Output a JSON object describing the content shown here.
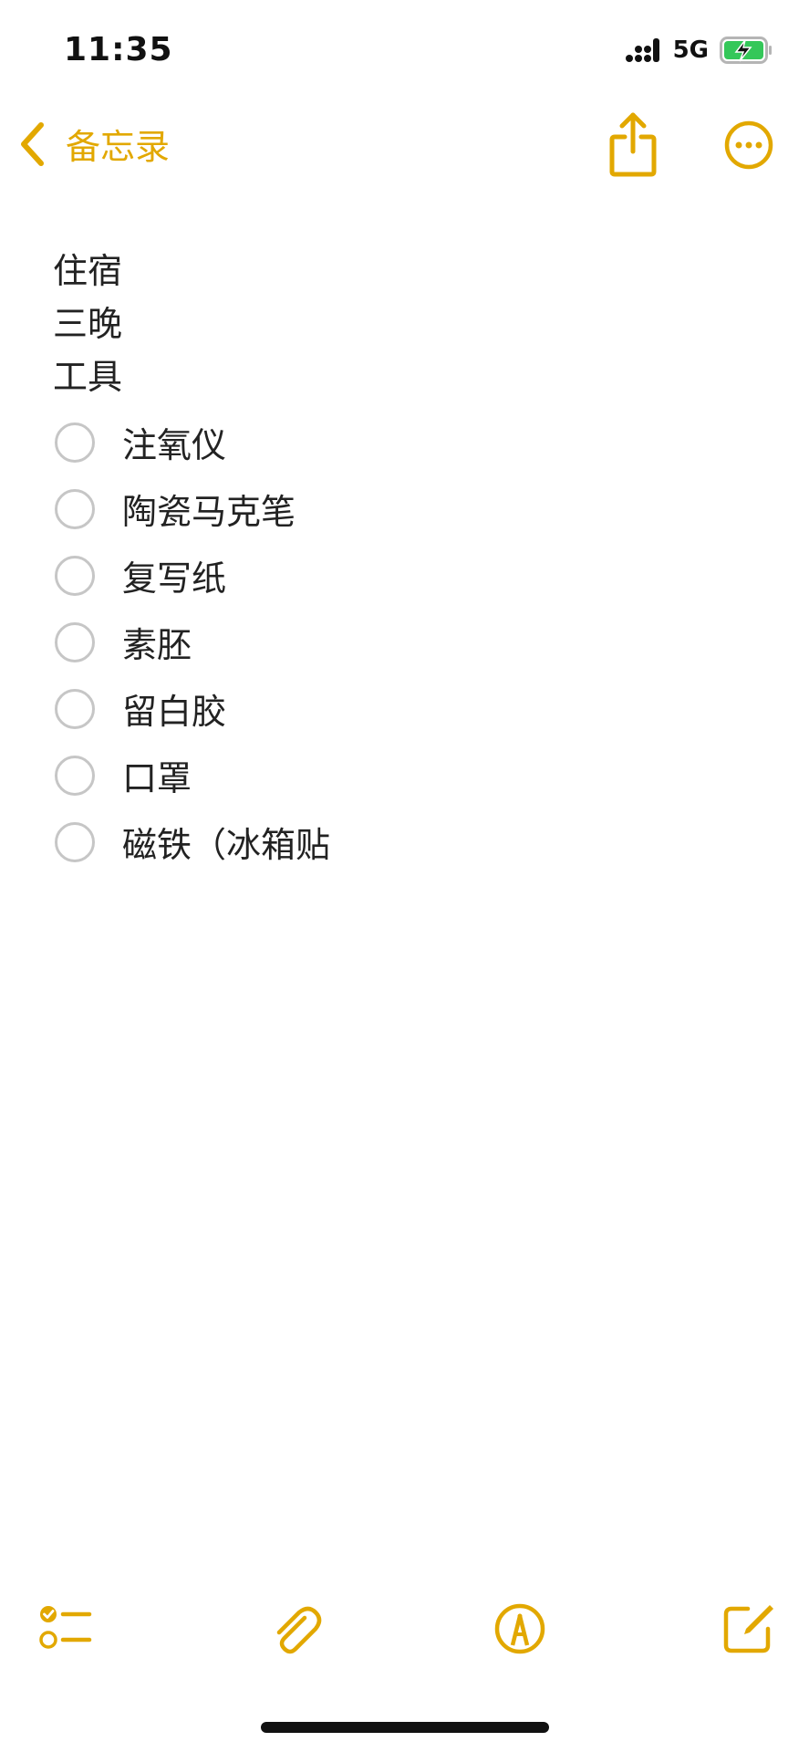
{
  "status_bar": {
    "time": "11:35",
    "network": "5G",
    "icons": [
      "signal-icon",
      "battery-charging-icon"
    ]
  },
  "nav": {
    "back_label": "备忘录",
    "icons": [
      "chevron-left-icon",
      "share-icon",
      "more-icon"
    ]
  },
  "note": {
    "lines": [
      "住宿",
      "三晚",
      "工具"
    ],
    "checklist": [
      {
        "text": "注氧仪",
        "checked": false
      },
      {
        "text": "陶瓷马克笔",
        "checked": false
      },
      {
        "text": "复写纸",
        "checked": false
      },
      {
        "text": "素胚",
        "checked": false
      },
      {
        "text": "留白胶",
        "checked": false
      },
      {
        "text": "口罩",
        "checked": false
      },
      {
        "text": "磁铁（冰箱贴",
        "checked": false
      }
    ]
  },
  "toolbar": {
    "icons": [
      "checklist-icon",
      "paperclip-icon",
      "markup-pen-icon",
      "compose-icon"
    ]
  },
  "colors": {
    "accent": "#E2A800",
    "text": "#222222",
    "checkbox_border": "#C6C6C6",
    "battery_fill": "#34C759"
  }
}
